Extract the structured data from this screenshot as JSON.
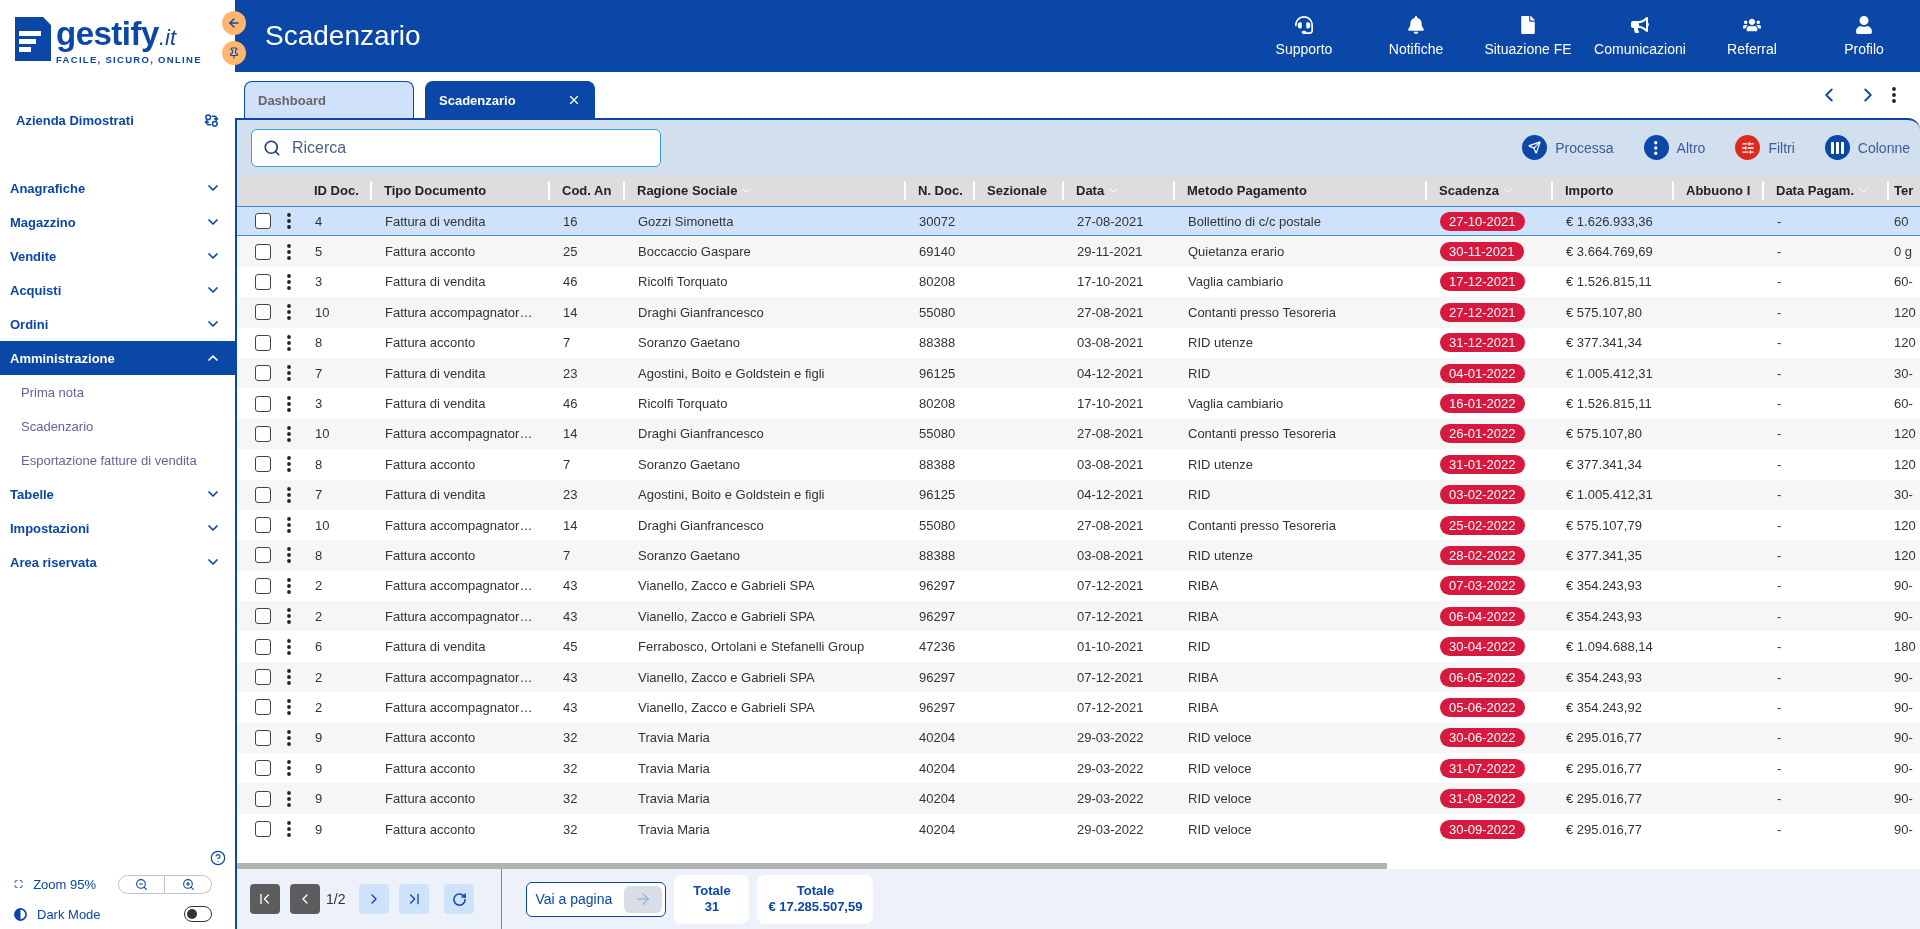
{
  "logo": {
    "name": "gestify",
    "suffix": ".it",
    "tagline": "FACILE, SICURO, ONLINE"
  },
  "header": {
    "title": "Scadenzario",
    "actions": [
      "Supporto",
      "Notifiche",
      "Situazione FE",
      "Comunicazioni",
      "Referral",
      "Profilo"
    ]
  },
  "sidebar": {
    "company": "Azienda Dimostrati",
    "items": [
      {
        "label": "Anagrafiche",
        "selected": false,
        "expanded": false
      },
      {
        "label": "Magazzino",
        "selected": false,
        "expanded": false
      },
      {
        "label": "Vendite",
        "selected": false,
        "expanded": false
      },
      {
        "label": "Acquisti",
        "selected": false,
        "expanded": false
      },
      {
        "label": "Ordini",
        "selected": false,
        "expanded": false
      },
      {
        "label": "Amministrazione",
        "selected": true,
        "expanded": true,
        "children": [
          {
            "label": "Prima nota",
            "selected": false
          },
          {
            "label": "Scadenzario",
            "selected": false
          },
          {
            "label": "Esportazione fatture di vendita",
            "selected": false
          }
        ]
      },
      {
        "label": "Tabelle",
        "selected": false,
        "expanded": false
      },
      {
        "label": "Impostazioni",
        "selected": false,
        "expanded": false
      },
      {
        "label": "Area riservata",
        "selected": false,
        "expanded": false
      }
    ],
    "zoom": "Zoom 95%",
    "dark_mode": {
      "label": "Dark Mode",
      "on": false
    }
  },
  "tabs": [
    {
      "label": "Dashboard",
      "selected": false,
      "closable": false
    },
    {
      "label": "Scadenzario",
      "selected": true,
      "closable": true
    }
  ],
  "toolbar": {
    "search": {
      "placeholder": "Ricerca"
    },
    "actions": [
      {
        "label": "Processa",
        "active": false
      },
      {
        "label": "Altro",
        "active": false
      },
      {
        "label": "Filtri",
        "active": true
      },
      {
        "label": "Colonne",
        "active": false
      }
    ]
  },
  "table": {
    "columns": [
      {
        "label": "ID Doc.",
        "sorted": false,
        "kind": "text"
      },
      {
        "label": "Tipo Documento",
        "sorted": false,
        "kind": "text"
      },
      {
        "label": "Cod. An",
        "sorted": false,
        "kind": "text"
      },
      {
        "label": "Ragione Sociale",
        "sorted": true,
        "kind": "text"
      },
      {
        "label": "N. Doc.",
        "sorted": false,
        "kind": "text"
      },
      {
        "label": "Sezionale",
        "sorted": false
      },
      {
        "label": "Data",
        "sorted": true,
        "kind": "text"
      },
      {
        "label": "Metodo Pagamento",
        "sorted": false,
        "kind": "text"
      },
      {
        "label": "Scadenza",
        "sorted": true,
        "kind": "badge"
      },
      {
        "label": "Importo",
        "sorted": false,
        "kind": "text"
      },
      {
        "label": "Abbuono I",
        "sorted": false
      },
      {
        "label": "Data Pagam.",
        "sorted": true,
        "kind": "text"
      },
      {
        "label": "Ter",
        "kind": "text"
      }
    ],
    "rows": [
      {
        "selected": true,
        "checked": false,
        "id_doc": "4",
        "document_type": "Fattura di vendita",
        "cod_an": "16",
        "company": "Gozzi Simonetta",
        "doc_number": "30072",
        "date": "27-08-2021",
        "payment_method": "Bollettino di c/c postale",
        "due_date": "27-10-2021",
        "amount": "€ 1.626.933,36",
        "payment_date": "-",
        "column_13": "60"
      },
      {
        "selected": false,
        "checked": false,
        "id_doc": "5",
        "document_type": "Fattura acconto",
        "cod_an": "25",
        "company": "Boccaccio Gaspare",
        "doc_number": "69140",
        "date": "29-11-2021",
        "payment_method": "Quietanza erario",
        "due_date": "30-11-2021",
        "amount": "€ 3.664.769,69",
        "payment_date": "-",
        "column_13": "0 g"
      },
      {
        "selected": false,
        "checked": false,
        "id_doc": "3",
        "document_type": "Fattura di vendita",
        "cod_an": "46",
        "company": "Ricolfi Torquato",
        "doc_number": "80208",
        "date": "17-10-2021",
        "payment_method": "Vaglia cambiario",
        "due_date": "17-12-2021",
        "amount": "€ 1.526.815,11",
        "payment_date": "-",
        "column_13": "60-"
      },
      {
        "selected": false,
        "checked": false,
        "id_doc": "10",
        "document_type": "Fattura accompagnator…",
        "cod_an": "14",
        "company": "Draghi Gianfrancesco",
        "doc_number": "55080",
        "date": "27-08-2021",
        "payment_method": "Contanti presso Tesoreria",
        "due_date": "27-12-2021",
        "amount": "€ 575.107,80",
        "payment_date": "-",
        "column_13": "120"
      },
      {
        "selected": false,
        "checked": false,
        "id_doc": "8",
        "document_type": "Fattura acconto",
        "cod_an": "7",
        "company": "Soranzo Gaetano",
        "doc_number": "88388",
        "date": "03-08-2021",
        "payment_method": "RID utenze",
        "due_date": "31-12-2021",
        "amount": "€ 377.341,34",
        "payment_date": "-",
        "column_13": "120"
      },
      {
        "selected": false,
        "checked": false,
        "id_doc": "7",
        "document_type": "Fattura di vendita",
        "cod_an": "23",
        "company": "Agostini, Boito e Goldstein e figli",
        "doc_number": "96125",
        "date": "04-12-2021",
        "payment_method": "RID",
        "due_date": "04-01-2022",
        "amount": "€ 1.005.412,31",
        "payment_date": "-",
        "column_13": "30-"
      },
      {
        "selected": false,
        "checked": false,
        "id_doc": "3",
        "document_type": "Fattura di vendita",
        "cod_an": "46",
        "company": "Ricolfi Torquato",
        "doc_number": "80208",
        "date": "17-10-2021",
        "payment_method": "Vaglia cambiario",
        "due_date": "16-01-2022",
        "amount": "€ 1.526.815,11",
        "payment_date": "-",
        "column_13": "60-"
      },
      {
        "selected": false,
        "checked": false,
        "id_doc": "10",
        "document_type": "Fattura accompagnator…",
        "cod_an": "14",
        "company": "Draghi Gianfrancesco",
        "doc_number": "55080",
        "date": "27-08-2021",
        "payment_method": "Contanti presso Tesoreria",
        "due_date": "26-01-2022",
        "amount": "€ 575.107,80",
        "payment_date": "-",
        "column_13": "120"
      },
      {
        "selected": false,
        "checked": false,
        "id_doc": "8",
        "document_type": "Fattura acconto",
        "cod_an": "7",
        "company": "Soranzo Gaetano",
        "doc_number": "88388",
        "date": "03-08-2021",
        "payment_method": "RID utenze",
        "due_date": "31-01-2022",
        "amount": "€ 377.341,34",
        "payment_date": "-",
        "column_13": "120"
      },
      {
        "selected": false,
        "checked": false,
        "id_doc": "7",
        "document_type": "Fattura di vendita",
        "cod_an": "23",
        "company": "Agostini, Boito e Goldstein e figli",
        "doc_number": "96125",
        "date": "04-12-2021",
        "payment_method": "RID",
        "due_date": "03-02-2022",
        "amount": "€ 1.005.412,31",
        "payment_date": "-",
        "column_13": "30-"
      },
      {
        "selected": false,
        "checked": false,
        "id_doc": "10",
        "document_type": "Fattura accompagnator…",
        "cod_an": "14",
        "company": "Draghi Gianfrancesco",
        "doc_number": "55080",
        "date": "27-08-2021",
        "payment_method": "Contanti presso Tesoreria",
        "due_date": "25-02-2022",
        "amount": "€ 575.107,79",
        "payment_date": "-",
        "column_13": "120"
      },
      {
        "selected": false,
        "checked": false,
        "id_doc": "8",
        "document_type": "Fattura acconto",
        "cod_an": "7",
        "company": "Soranzo Gaetano",
        "doc_number": "88388",
        "date": "03-08-2021",
        "payment_method": "RID utenze",
        "due_date": "28-02-2022",
        "amount": "€ 377.341,35",
        "payment_date": "-",
        "column_13": "120"
      },
      {
        "selected": false,
        "checked": false,
        "id_doc": "2",
        "document_type": "Fattura accompagnator…",
        "cod_an": "43",
        "company": "Vianello, Zacco e Gabrieli SPA",
        "doc_number": "96297",
        "date": "07-12-2021",
        "payment_method": "RIBA",
        "due_date": "07-03-2022",
        "amount": "€ 354.243,93",
        "payment_date": "-",
        "column_13": "90-"
      },
      {
        "selected": false,
        "checked": false,
        "id_doc": "2",
        "document_type": "Fattura accompagnator…",
        "cod_an": "43",
        "company": "Vianello, Zacco e Gabrieli SPA",
        "doc_number": "96297",
        "date": "07-12-2021",
        "payment_method": "RIBA",
        "due_date": "06-04-2022",
        "amount": "€ 354.243,93",
        "payment_date": "-",
        "column_13": "90-"
      },
      {
        "selected": false,
        "checked": false,
        "id_doc": "6",
        "document_type": "Fattura di vendita",
        "cod_an": "45",
        "company": "Ferrabosco, Ortolani e Stefanelli Group",
        "doc_number": "47236",
        "date": "01-10-2021",
        "payment_method": "RID",
        "due_date": "30-04-2022",
        "amount": "€ 1.094.688,14",
        "payment_date": "-",
        "column_13": "180"
      },
      {
        "selected": false,
        "checked": false,
        "id_doc": "2",
        "document_type": "Fattura accompagnator…",
        "cod_an": "43",
        "company": "Vianello, Zacco e Gabrieli SPA",
        "doc_number": "96297",
        "date": "07-12-2021",
        "payment_method": "RIBA",
        "due_date": "06-05-2022",
        "amount": "€ 354.243,93",
        "payment_date": "-",
        "column_13": "90-"
      },
      {
        "selected": false,
        "checked": false,
        "id_doc": "2",
        "document_type": "Fattura accompagnator…",
        "cod_an": "43",
        "company": "Vianello, Zacco e Gabrieli SPA",
        "doc_number": "96297",
        "date": "07-12-2021",
        "payment_method": "RIBA",
        "due_date": "05-06-2022",
        "amount": "€ 354.243,92",
        "payment_date": "-",
        "column_13": "90-"
      },
      {
        "selected": false,
        "checked": false,
        "id_doc": "9",
        "document_type": "Fattura acconto",
        "cod_an": "32",
        "company": "Travia Maria",
        "doc_number": "40204",
        "date": "29-03-2022",
        "payment_method": "RID veloce",
        "due_date": "30-06-2022",
        "amount": "€ 295.016,77",
        "payment_date": "-",
        "column_13": "90-"
      },
      {
        "selected": false,
        "checked": false,
        "id_doc": "9",
        "document_type": "Fattura acconto",
        "cod_an": "32",
        "company": "Travia Maria",
        "doc_number": "40204",
        "date": "29-03-2022",
        "payment_method": "RID veloce",
        "due_date": "31-07-2022",
        "amount": "€ 295.016,77",
        "payment_date": "-",
        "column_13": "90-"
      },
      {
        "selected": false,
        "checked": false,
        "id_doc": "9",
        "document_type": "Fattura acconto",
        "cod_an": "32",
        "company": "Travia Maria",
        "doc_number": "40204",
        "date": "29-03-2022",
        "payment_method": "RID veloce",
        "due_date": "31-08-2022",
        "amount": "€ 295.016,77",
        "payment_date": "-",
        "column_13": "90-"
      },
      {
        "selected": false,
        "checked": false,
        "id_doc": "9",
        "document_type": "Fattura acconto",
        "cod_an": "32",
        "company": "Travia Maria",
        "doc_number": "40204",
        "date": "29-03-2022",
        "payment_method": "RID veloce",
        "due_date": "30-09-2022",
        "amount": "€ 295.016,77",
        "payment_date": "-",
        "column_13": "90-"
      }
    ]
  },
  "pagination": {
    "nav": [
      {
        "disabled": true
      },
      {
        "disabled": true
      },
      {
        "disabled": false
      },
      {
        "disabled": false
      }
    ],
    "page": "1/2",
    "goto": {
      "placeholder": "Vai a pagina"
    },
    "totals": [
      {
        "label": "Totale",
        "value": "31"
      },
      {
        "label": "Totale",
        "value": "€ 17.285.507,59"
      }
    ]
  }
}
